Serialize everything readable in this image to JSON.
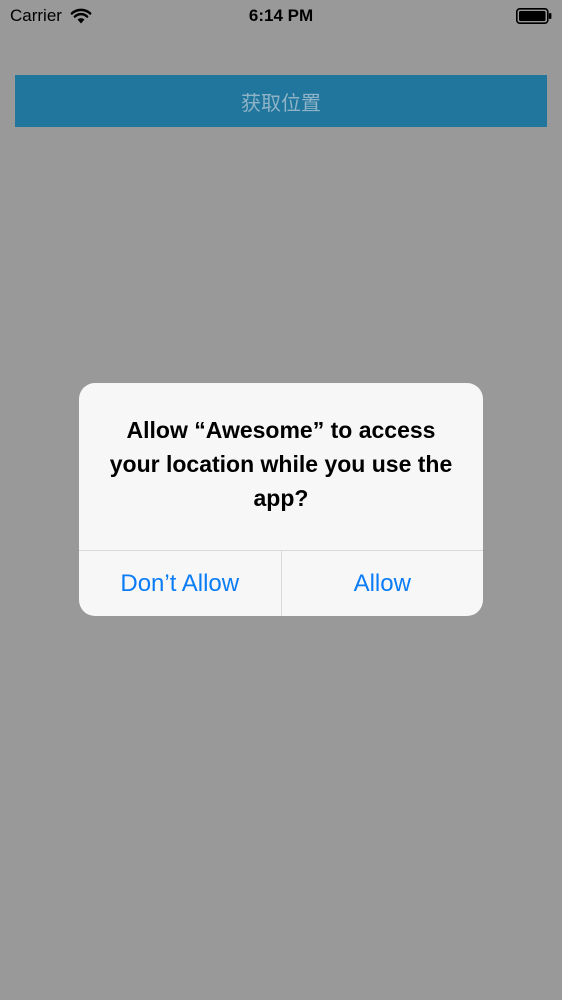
{
  "status_bar": {
    "carrier": "Carrier",
    "time": "6:14 PM",
    "wifi_icon": "wifi-icon",
    "battery_icon": "battery-icon"
  },
  "main": {
    "button_label": "获取位置",
    "button_color": "#21769e"
  },
  "alert": {
    "title": "Allow “Awesome” to access your location while you use the app?",
    "buttons": [
      {
        "label": "Don’t Allow"
      },
      {
        "label": "Allow"
      }
    ],
    "accent_color": "#0a7cf5"
  }
}
